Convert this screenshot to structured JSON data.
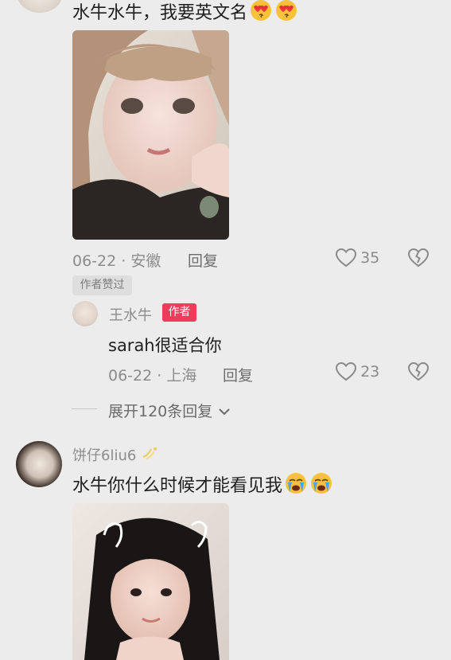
{
  "comments": [
    {
      "text": "水牛水牛，我要英文名",
      "emoji": [
        "heart-eyes-kiss-emoji",
        "heart-eyes-kiss-emoji"
      ],
      "date_location": "06-22 · 安徽",
      "reply_label": "回复",
      "like_count": "35",
      "liked_by_author_badge": "作者赞过"
    },
    {
      "username": "饼仔6liu6",
      "text": "水牛你什么时候才能看见我",
      "emoji": [
        "crying-face-emoji",
        "crying-face-emoji"
      ]
    }
  ],
  "replies": [
    {
      "username": "王水牛",
      "tag": "作者",
      "text": "sarah很适合你",
      "date_location": "06-22 · 上海",
      "reply_label": "回复",
      "like_count": "23"
    }
  ],
  "expand_replies_label": "展开120条回复",
  "colors": {
    "background": "#ececec",
    "author_tag": "#ef3c5a",
    "text_primary": "#1f1f1f",
    "text_secondary": "#8b8b8b"
  },
  "icons": [
    "heart-outline-icon",
    "broken-heart-icon",
    "chevron-down-icon",
    "sparkle-icon"
  ]
}
